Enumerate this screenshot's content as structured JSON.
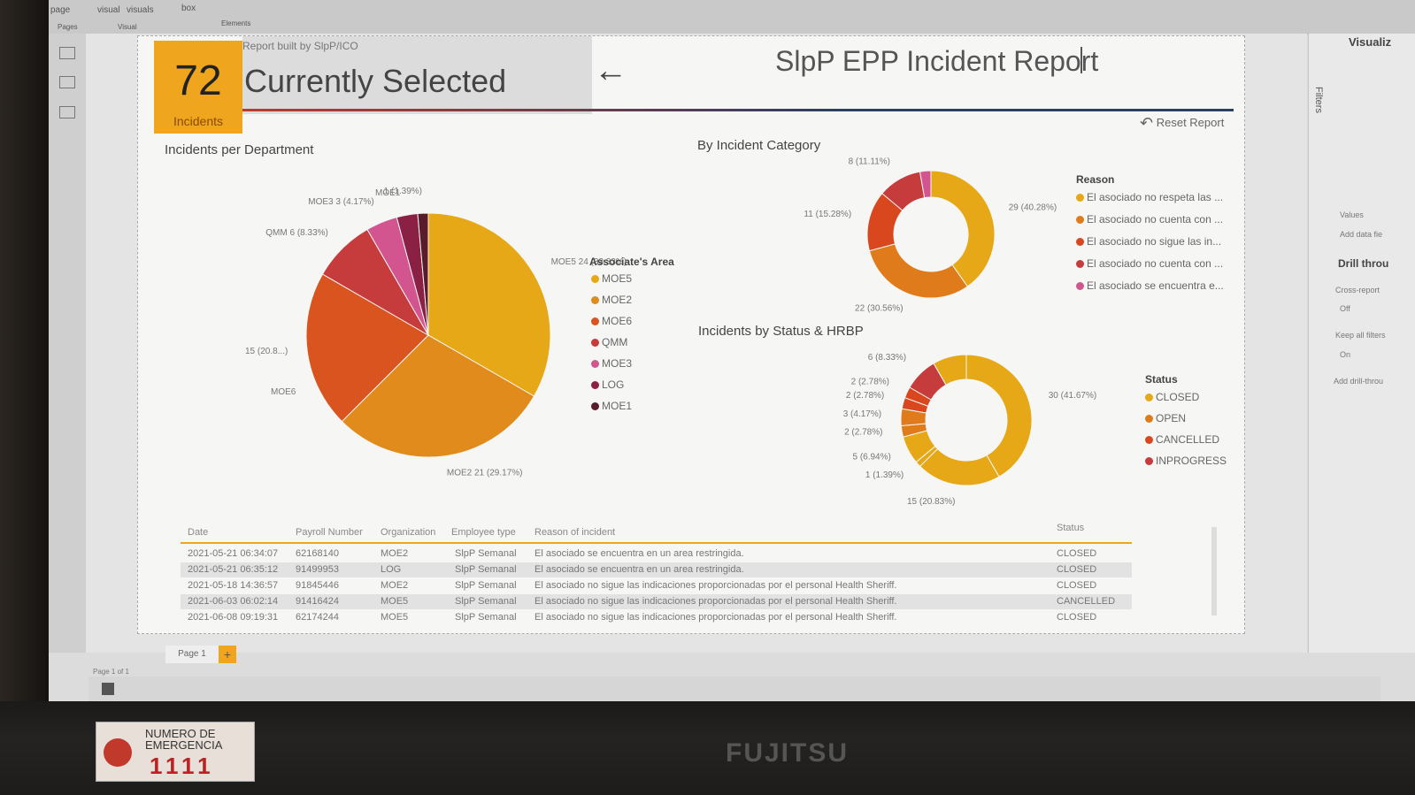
{
  "ribbon": {
    "page": "page",
    "visual": "visual",
    "visuals": "visuals",
    "box": "box",
    "pages": "Pages",
    "visual_group": "Visual",
    "elements": "Elements"
  },
  "kpi": {
    "value": "72",
    "label": "Incidents"
  },
  "selection": {
    "subtitle": "Report built by SlpP/ICO",
    "label": "Currently Selected"
  },
  "title": "SlpP EPP Incident Report",
  "reset": "Reset Report",
  "dept": {
    "heading": "Incidents per Department",
    "legend_title": "Associate's Area",
    "chart_data": {
      "type": "pie",
      "title": "Incidents per Department",
      "slices": [
        {
          "name": "MOE5",
          "value": 24,
          "label": "MOE5 24 (33.33%)",
          "color": "#e6a817"
        },
        {
          "name": "MOE2",
          "value": 21,
          "label": "MOE2 21 (29.17%)",
          "color": "#e08b1c"
        },
        {
          "name": "MOE6",
          "value": 15,
          "label": "15 (20.8...)",
          "color": "#d9541f"
        },
        {
          "name": "QMM",
          "value": 6,
          "label": "QMM 6 (8.33%)",
          "color": "#c63b3b"
        },
        {
          "name": "MOE3",
          "value": 3,
          "label": "MOE3 3 (4.17%)",
          "color": "#d25590"
        },
        {
          "name": "LOG",
          "value": 2,
          "label": "",
          "color": "#8a2145"
        },
        {
          "name": "MOE1",
          "value": 1,
          "label": "1 (1.39%)",
          "color": "#5a1b2b"
        }
      ]
    },
    "moe6_label": "MOE6",
    "moe1_label": "MOE1"
  },
  "category": {
    "heading": "By Incident Category",
    "legend_title": "Reason",
    "chart_data": {
      "type": "pie",
      "title": "By Incident Category",
      "slices": [
        {
          "name": "El asociado no respeta las ...",
          "value": 29,
          "label": "29 (40.28%)",
          "color": "#e6a817"
        },
        {
          "name": "El asociado no cuenta con ...",
          "value": 22,
          "label": "22 (30.56%)",
          "color": "#e07b1c"
        },
        {
          "name": "El asociado no sigue las in...",
          "value": 11,
          "label": "11 (15.28%)",
          "color": "#d9471f"
        },
        {
          "name": "El asociado no cuenta con ...",
          "value": 8,
          "label": "8 (11.11%)",
          "color": "#c63b3b"
        },
        {
          "name": "El asociado se encuentra e...",
          "value": 2,
          "label": "",
          "color": "#d25590"
        }
      ]
    }
  },
  "status": {
    "heading": "Incidents by Status & HRBP",
    "legend_title": "Status",
    "legend": [
      {
        "name": "CLOSED",
        "color": "#e6a817"
      },
      {
        "name": "OPEN",
        "color": "#e07b1c"
      },
      {
        "name": "CANCELLED",
        "color": "#d9471f"
      },
      {
        "name": "INPROGRESS",
        "color": "#c63b3b"
      }
    ],
    "chart_data": {
      "type": "pie",
      "title": "Incidents by Status & HRBP",
      "slices": [
        {
          "value": 30,
          "label": "30 (41.67%)",
          "color": "#e6a817"
        },
        {
          "value": 15,
          "label": "15 (20.83%)",
          "color": "#e6a817"
        },
        {
          "value": 1,
          "label": "1 (1.39%)",
          "color": "#e6a817"
        },
        {
          "value": 5,
          "label": "5 (6.94%)",
          "color": "#e6a817"
        },
        {
          "value": 2,
          "label": "2 (2.78%)",
          "color": "#e07b1c"
        },
        {
          "value": 3,
          "label": "3 (4.17%)",
          "color": "#e07b1c"
        },
        {
          "value": 2,
          "label": "2 (2.78%)",
          "color": "#d9471f"
        },
        {
          "value": 2,
          "label": "2 (2.78%)",
          "color": "#d9471f"
        },
        {
          "value": 6,
          "label": "6 (8.33%)",
          "color": "#c63b3b"
        },
        {
          "value": 6,
          "label": "",
          "color": "#e6a817"
        }
      ]
    }
  },
  "table": {
    "headers": [
      "Date",
      "Payroll Number",
      "Organization",
      "Employee type",
      "Reason of incident",
      "Status"
    ],
    "rows": [
      [
        "2021-05-21 06:34:07",
        "62168140",
        "MOE2",
        "SlpP Semanal",
        "El asociado se encuentra en un area restringida.",
        "CLOSED"
      ],
      [
        "2021-05-21 06:35:12",
        "91499953",
        "LOG",
        "SlpP Semanal",
        "El asociado se encuentra en un area restringida.",
        "CLOSED"
      ],
      [
        "2021-05-18 14:36:57",
        "91845446",
        "MOE2",
        "SlpP Semanal",
        "El asociado no sigue las indicaciones proporcionadas por el personal Health Sheriff.",
        "CLOSED"
      ],
      [
        "2021-06-03 06:02:14",
        "91416424",
        "MOE5",
        "SlpP Semanal",
        "El asociado no sigue las indicaciones proporcionadas por el personal Health Sheriff.",
        "CANCELLED"
      ],
      [
        "2021-06-08 09:19:31",
        "62174244",
        "MOE5",
        "SlpP Semanal",
        "El asociado no sigue las indicaciones proporcionadas por el personal Health Sheriff.",
        "CLOSED"
      ]
    ]
  },
  "pages": {
    "tab": "Page 1",
    "indicator": "Page 1 of 1",
    "add": "+"
  },
  "rightpane": {
    "title": "Visualiz",
    "filters": "Filters",
    "values": "Values",
    "add_data": "Add data fie",
    "drill": "Drill throu",
    "cross": "Cross-report",
    "off": "Off",
    "keep": "Keep all filters",
    "on": "On",
    "add_drill": "Add drill-throu"
  },
  "sticker": {
    "line1": "NUMERO DE",
    "line2": "EMERGENCIA",
    "number": "1111"
  },
  "brand": "FUJITSU"
}
